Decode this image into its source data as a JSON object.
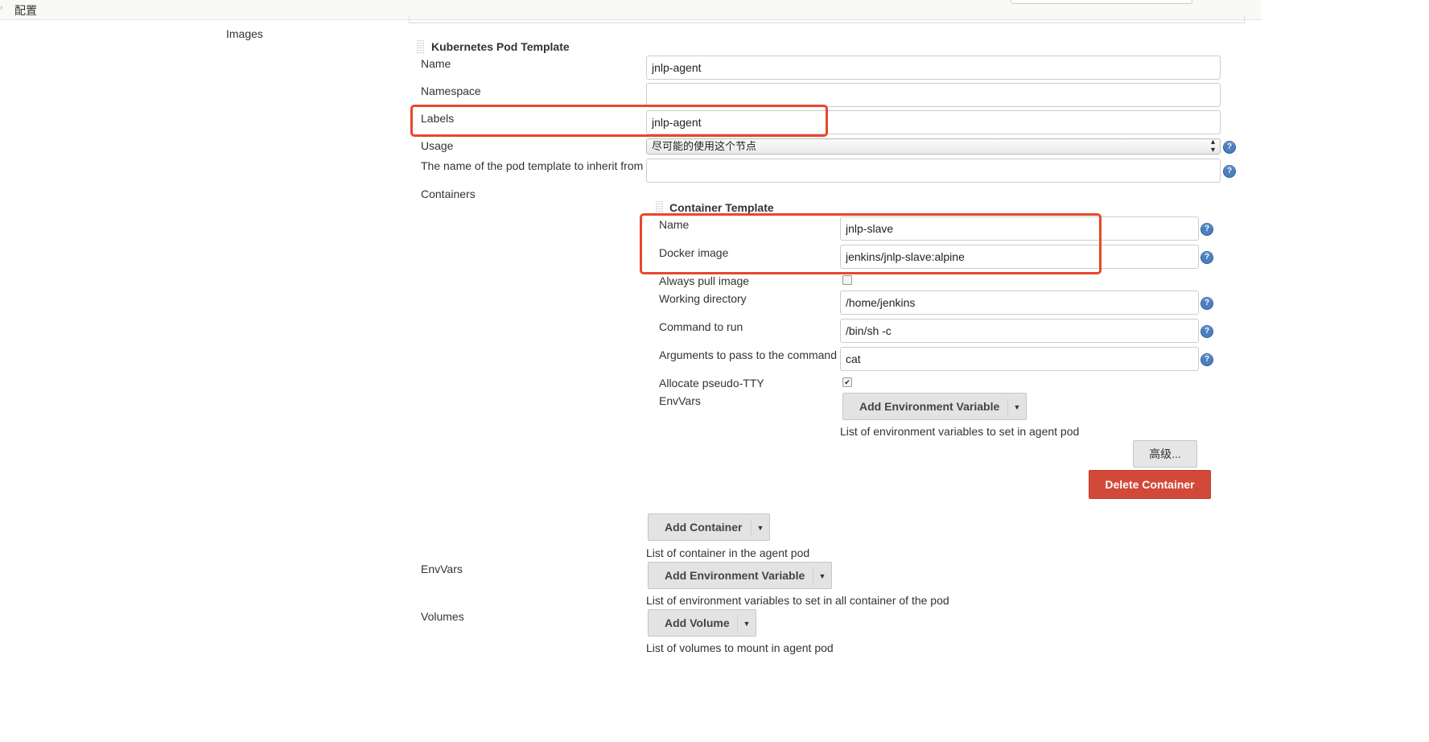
{
  "breadcrumb": {
    "label": "配置"
  },
  "images_label": "Images",
  "pod_template": {
    "title": "Kubernetes Pod Template",
    "name_label": "Name",
    "name_value": "jnlp-agent",
    "namespace_label": "Namespace",
    "namespace_value": "",
    "labels_label": "Labels",
    "labels_value": "jnlp-agent",
    "usage_label": "Usage",
    "usage_value": "尽可能的使用这个节点",
    "inherit_label": "The name of the pod template to inherit from",
    "inherit_value": "",
    "containers_label": "Containers"
  },
  "container_template": {
    "title": "Container Template",
    "name_label": "Name",
    "name_value": "jnlp-slave",
    "docker_image_label": "Docker image",
    "docker_image_value": "jenkins/jnlp-slave:alpine",
    "always_pull_label": "Always pull image",
    "always_pull_checked": false,
    "working_dir_label": "Working directory",
    "working_dir_value": "/home/jenkins",
    "command_label": "Command to run",
    "command_value": "/bin/sh -c",
    "args_label": "Arguments to pass to the command",
    "args_value": "cat",
    "tty_label": "Allocate pseudo-TTY",
    "tty_checked": true,
    "envvars_label": "EnvVars",
    "add_env_button": "Add Environment Variable",
    "envvars_desc": "List of environment variables to set in agent pod",
    "advanced_button": "高级...",
    "delete_button": "Delete Container"
  },
  "add_container_button": "Add Container",
  "containers_desc": "List of container in the agent pod",
  "pod_envvars_label": "EnvVars",
  "pod_add_env_button": "Add Environment Variable",
  "pod_envvars_desc": "List of environment variables to set in all container of the pod",
  "volumes_label": "Volumes",
  "add_volume_button": "Add Volume",
  "volumes_desc": "List of volumes to mount in agent pod",
  "help_glyph": "?",
  "colors": {
    "highlight": "#e8472c",
    "danger": "#d24939",
    "help": "#4a7fc1"
  }
}
